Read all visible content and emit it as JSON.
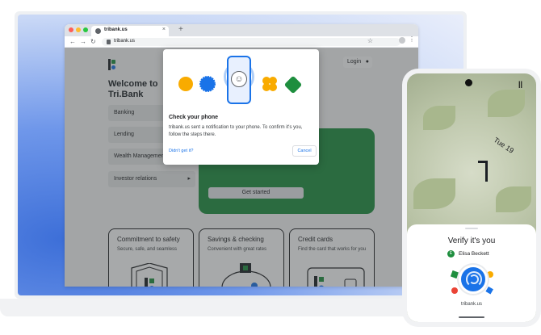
{
  "browser": {
    "tab_title": "tribank.us",
    "tab_close": "×",
    "new_tab": "+",
    "url": "tribank.us",
    "back": "←",
    "forward": "→",
    "reload": "↻",
    "star": "☆",
    "menu": "⋮"
  },
  "site": {
    "login_label": "Login",
    "welcome": "Welcome to Tri.Bank",
    "menu": [
      {
        "label": "Banking"
      },
      {
        "label": "Lending"
      },
      {
        "label": "Wealth Management"
      },
      {
        "label": "Investor relations",
        "chevron": "▸"
      }
    ],
    "get_started": "Get started",
    "cards": [
      {
        "title": "Commitment to safety",
        "subtitle": "Secure, safe, and seamless"
      },
      {
        "title": "Savings & checking",
        "subtitle": "Convenient with great rates"
      },
      {
        "title": "Credit cards",
        "subtitle": "Find the card that works for you"
      }
    ]
  },
  "dialog": {
    "title": "Check your phone",
    "body": "tribank.us sent a notification to your phone. To confirm it's you, follow the steps there.",
    "didnt_get_it": "Didn't get it?",
    "cancel": "Cancel"
  },
  "phone": {
    "clock": "Tue 19",
    "verify_title": "Verify it's you",
    "user_name": "Elisa Beckett",
    "user_initial": "E",
    "domain": "tribank.us"
  },
  "icons": {
    "person": "person-icon",
    "fingerprint": "fingerprint-icon",
    "lock": "lock-icon"
  },
  "colors": {
    "brand_green": "#1e8e3e",
    "brand_blue": "#1a73e8",
    "accent_yellow": "#f9ab00"
  }
}
